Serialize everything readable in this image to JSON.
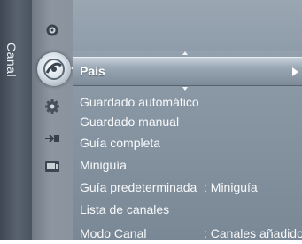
{
  "sidebar": {
    "label": "Canal"
  },
  "menu": {
    "selected": {
      "label": "País"
    },
    "items": [
      {
        "label": "Guardado automático",
        "value": ""
      },
      {
        "label": "Guardado manual",
        "value": ""
      },
      {
        "label": "Guía completa",
        "value": ""
      },
      {
        "label": "Miniguía",
        "value": ""
      },
      {
        "label": "Guía predeterminada",
        "value": ": Miniguía"
      },
      {
        "label": "Lista de canales",
        "value": ""
      },
      {
        "label": "Modo Canal",
        "value": ": Canales añadidos"
      }
    ]
  },
  "icons": [
    "picture-icon",
    "channel-icon",
    "setup-icon",
    "input-icon",
    "application-icon"
  ]
}
